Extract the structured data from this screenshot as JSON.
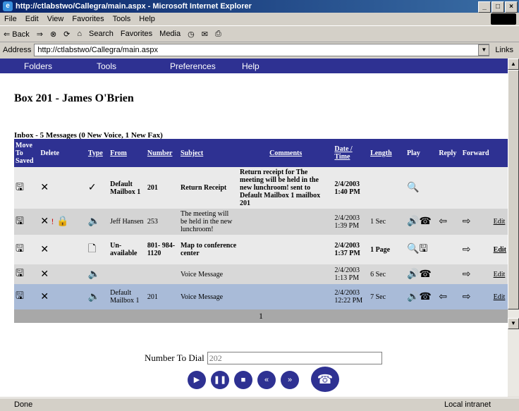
{
  "window": {
    "title": "http://ctlabstwo/Callegra/main.aspx - Microsoft Internet Explorer"
  },
  "menu": [
    "File",
    "Edit",
    "View",
    "Favorites",
    "Tools",
    "Help"
  ],
  "toolbar": {
    "back": "⇐ Back",
    "forward": "⇒",
    "search": "Search",
    "favorites": "Favorites",
    "media": "Media"
  },
  "address": {
    "label": "Address",
    "url": "http://ctlabstwo/Callegra/main.aspx",
    "links": "Links"
  },
  "nav": {
    "folders": "Folders",
    "tools": "Tools",
    "preferences": "Preferences",
    "help": "Help"
  },
  "page": {
    "box_title": "Box 201 - James O'Brien",
    "inbox_summary": "Inbox - 5 Messages (0 New Voice, 1 New Fax)"
  },
  "table": {
    "headers": {
      "move": "Move To Saved",
      "delete": "Delete",
      "type": "Type",
      "from": "From",
      "number": "Number",
      "subject": "Subject",
      "comments": "Comments",
      "date": "Date / Time",
      "length": "Length",
      "play": "Play",
      "reply": "Reply",
      "forward": "Forward"
    },
    "rows": [
      {
        "from": "Default Mailbox 1",
        "number": "201",
        "subject": "Return Receipt",
        "comments": "Return receipt for The meeting will be held in the new lunchroom! sent to Default Mailbox 1 mailbox 201",
        "date": "2/4/2003 1:40 PM",
        "length": "",
        "edit": ""
      },
      {
        "from": "Jeff Hansen",
        "number": "253",
        "subject": "The meeting will be held in the new lunchroom!",
        "comments": "",
        "date": "2/4/2003 1:39 PM",
        "length": "1 Sec",
        "edit": "Edit"
      },
      {
        "from": "Un- available",
        "number": "801- 984- 1120",
        "subject": "Map to conference center",
        "comments": "",
        "date": "2/4/2003 1:37 PM",
        "length": "1 Page",
        "edit": "Edit"
      },
      {
        "from": "",
        "number": "",
        "subject": "Voice Message",
        "comments": "",
        "date": "2/4/2003 1:13 PM",
        "length": "6 Sec",
        "edit": "Edit"
      },
      {
        "from": "Default Mailbox 1",
        "number": "201",
        "subject": "Voice Message",
        "comments": "",
        "date": "2/4/2003 12:22 PM",
        "length": "7 Sec",
        "edit": "Edit"
      }
    ],
    "page_number": "1"
  },
  "dial": {
    "label": "Number To Dial",
    "value": "202"
  },
  "status": {
    "text": "Done",
    "zone": "Local intranet"
  },
  "colors": {
    "nav_bg": "#2e3192",
    "selected_row": "#a9bbd8"
  }
}
